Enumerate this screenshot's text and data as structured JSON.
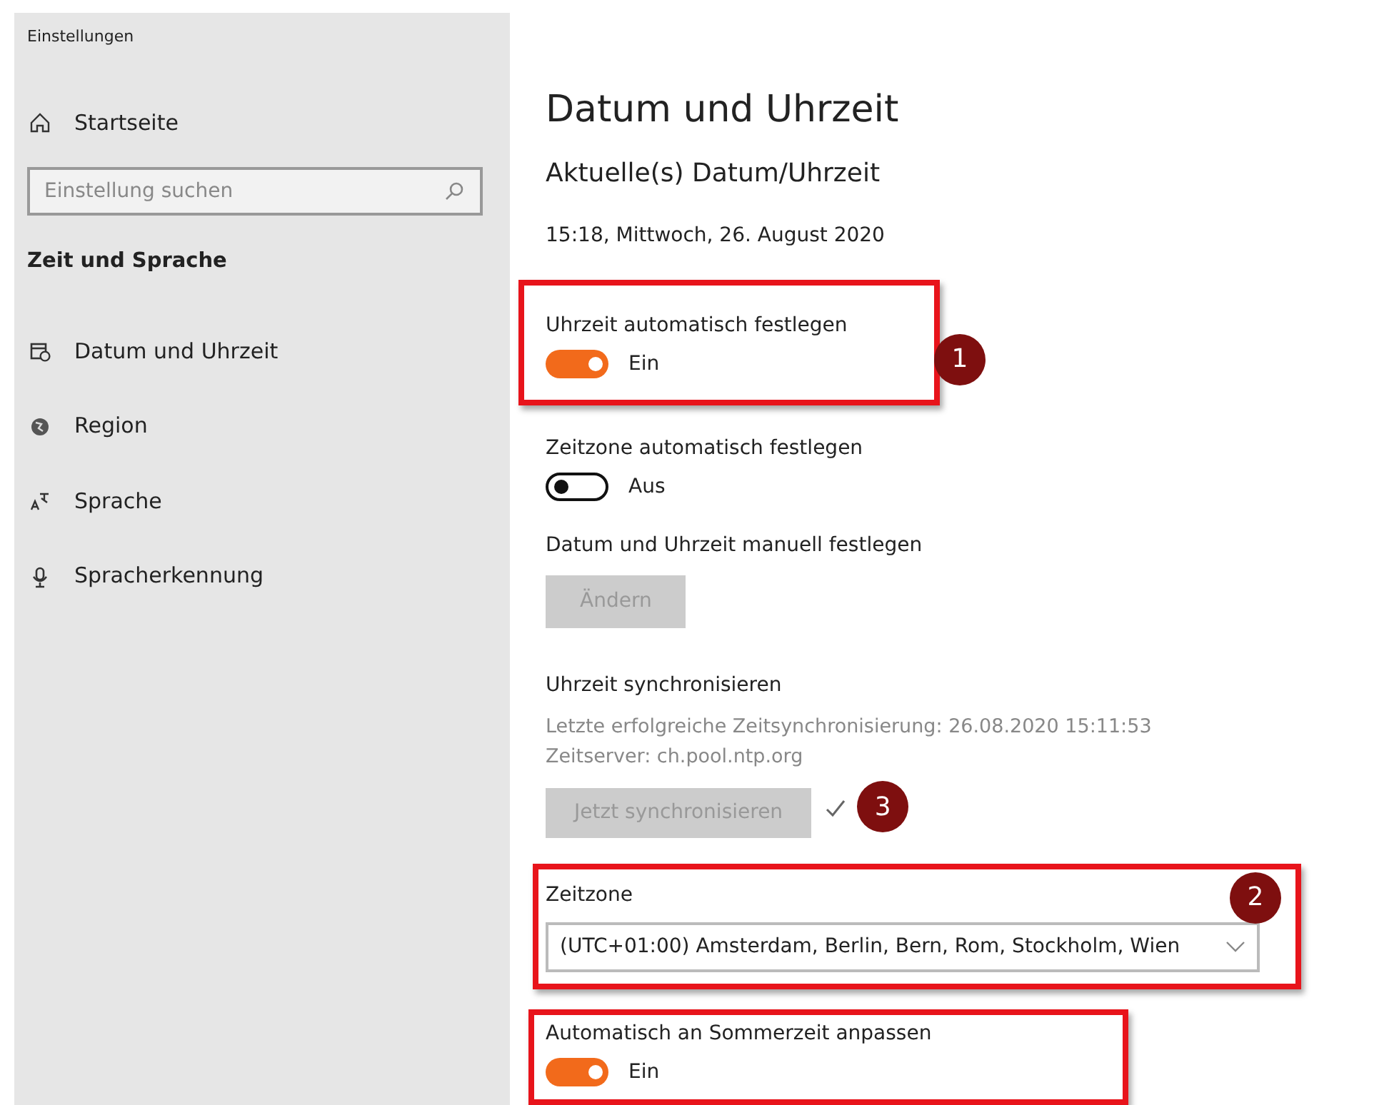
{
  "window": {
    "title": "Einstellungen"
  },
  "sidebar": {
    "home": "Startseite",
    "search": {
      "placeholder": "Einstellung suchen"
    },
    "section": "Zeit und Sprache",
    "items": [
      {
        "label": "Datum und Uhrzeit"
      },
      {
        "label": "Region"
      },
      {
        "label": "Sprache"
      },
      {
        "label": "Spracherkennung"
      }
    ]
  },
  "page": {
    "title": "Datum und Uhrzeit",
    "subtitle": "Aktuelle(s) Datum/Uhrzeit",
    "current": "15:18, Mittwoch, 26. August 2020",
    "settings": [
      {
        "kind": "toggle",
        "label": "Uhrzeit automatisch festlegen",
        "on": true,
        "state": "Ein",
        "highlight": true,
        "callout": "1"
      },
      {
        "kind": "toggle",
        "label": "Zeitzone automatisch festlegen",
        "on": false,
        "state": "Aus",
        "highlight": false
      },
      {
        "kind": "button",
        "label": "Datum und Uhrzeit manuell festlegen",
        "button": "Ändern",
        "disabled": true,
        "highlight": false
      },
      {
        "kind": "sync",
        "label": "Uhrzeit synchronisieren",
        "info": [
          "Letzte erfolgreiche Zeitsynchronisierung: 26.08.2020 15:11:53",
          "Zeitserver: ch.pool.ntp.org"
        ],
        "button": "Jetzt synchronisieren",
        "disabled": true,
        "done": true,
        "highlight": false,
        "callout": "3"
      },
      {
        "kind": "select",
        "label": "Zeitzone",
        "value": "(UTC+01:00) Amsterdam, Berlin, Bern, Rom, Stockholm, Wien",
        "highlight": true,
        "callout": "2"
      },
      {
        "kind": "toggle",
        "label": "Automatisch an Sommerzeit anpassen",
        "on": true,
        "state": "Ein",
        "highlight": true
      }
    ]
  }
}
